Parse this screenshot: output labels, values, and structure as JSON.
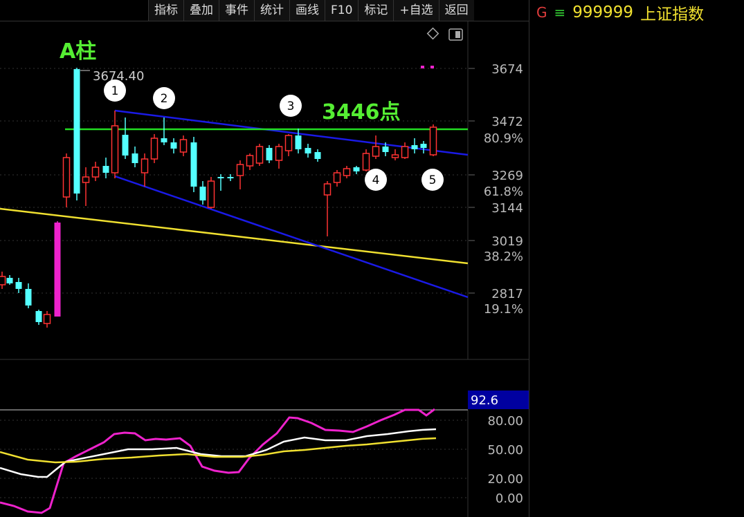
{
  "toolbar": [
    "指标",
    "叠加",
    "事件",
    "统计",
    "画线",
    "F10",
    "标记",
    "+自选",
    "返回"
  ],
  "sidebar": {
    "g_icon": "G",
    "menu_icon": "≡",
    "code": "999999",
    "name": "上证指数",
    "colors": {
      "g": "#e03c3c",
      "menu": "#33cc33",
      "text": "#f0e030"
    }
  },
  "icons": {
    "diamond": "diamond-icon",
    "panel_toggle": "panel-toggle-icon"
  },
  "main_chart": {
    "annotation_a": "A柱",
    "annotation_level": "3446点",
    "high_label": "3674.40",
    "wave_labels": [
      "1",
      "2",
      "3",
      "4",
      "5"
    ],
    "price_ticks": [
      "3674",
      "3472",
      "3269",
      "3144",
      "3019",
      "2817"
    ],
    "pct_ticks": [
      "80.9%",
      "61.8%",
      "38.2%",
      "19.1%"
    ],
    "colors": {
      "up": "#ff3333",
      "down": "#54ffff",
      "green_line": "#22dd22",
      "trend": "#1a1ae6",
      "yellow": "#f0e030",
      "magenta": "#ee22cc",
      "annotation": "#55ee33"
    }
  },
  "indicator": {
    "value_badge": "92.6",
    "ticks": [
      "80.00",
      "50.00",
      "20.00",
      "0.00"
    ]
  }
}
